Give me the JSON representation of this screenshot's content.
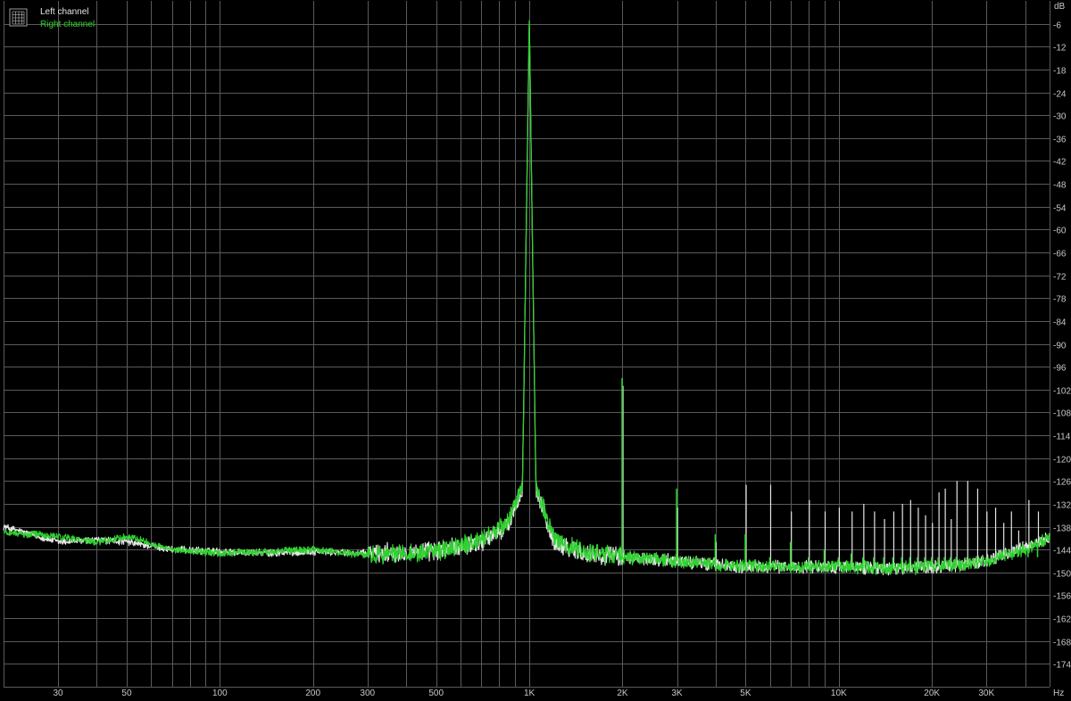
{
  "colors": {
    "background": "#000000",
    "grid": "#5a5a5a",
    "tick_text": "#c8c8c8",
    "left_channel": "#e6e6e6",
    "right_channel": "#2fd22f",
    "legend_icon": "#9a9a9a"
  },
  "legend": {
    "icon": "grid-icon",
    "placement": "top-left",
    "items": [
      {
        "label": "Left channel",
        "color": "#e6e6e6"
      },
      {
        "label": "Right channel",
        "color": "#2fd22f"
      }
    ]
  },
  "chart_data": {
    "type": "line",
    "title": "",
    "xscale": "log",
    "xlim": [
      20,
      48000
    ],
    "ylim": [
      -180,
      0
    ],
    "xunit": "Hz",
    "yunit": "dB",
    "xticks": [
      {
        "value": 30,
        "label": "30"
      },
      {
        "value": 50,
        "label": "50"
      },
      {
        "value": 100,
        "label": "100"
      },
      {
        "value": 200,
        "label": "200"
      },
      {
        "value": 300,
        "label": "300"
      },
      {
        "value": 500,
        "label": "500"
      },
      {
        "value": 1000,
        "label": "1K"
      },
      {
        "value": 2000,
        "label": "2K"
      },
      {
        "value": 3000,
        "label": "3K"
      },
      {
        "value": 5000,
        "label": "5K"
      },
      {
        "value": 10000,
        "label": "10K"
      },
      {
        "value": 20000,
        "label": "20K"
      },
      {
        "value": 30000,
        "label": "30K"
      }
    ],
    "yticks": [
      -6,
      -12,
      -18,
      -24,
      -30,
      -36,
      -42,
      -48,
      -54,
      -60,
      -66,
      -72,
      -78,
      -84,
      -90,
      -96,
      -102,
      -108,
      -114,
      -120,
      -126,
      -132,
      -138,
      -144,
      -150,
      -156,
      -162,
      -168,
      -174
    ],
    "grid": true,
    "noise_floor": {
      "x": [
        20,
        30,
        40,
        50,
        70,
        100,
        150,
        200,
        300,
        500,
        700,
        850,
        950,
        1000,
        1050,
        1200,
        1500,
        2000,
        3000,
        5000,
        7000,
        10000,
        15000,
        20000,
        25000,
        30000,
        40000,
        48000
      ],
      "left": [
        -138,
        -142,
        -141.5,
        -142,
        -144,
        -144.5,
        -145,
        -144.5,
        -145,
        -144.5,
        -142,
        -138,
        -128,
        -5,
        -128,
        -142,
        -145,
        -146,
        -147,
        -148.5,
        -148.5,
        -148.5,
        -149,
        -148.5,
        -148,
        -147,
        -143.5,
        -141
      ],
      "right": [
        -139.5,
        -140.5,
        -142,
        -140.5,
        -144,
        -145,
        -144.5,
        -144,
        -145.5,
        -144.5,
        -141.5,
        -137,
        -127,
        -4,
        -127,
        -141,
        -144.5,
        -146,
        -147,
        -148.5,
        -148.5,
        -148.5,
        -149,
        -148.5,
        -148,
        -147,
        -144,
        -141
      ]
    },
    "spurs": [
      {
        "x": 2000,
        "left": -101,
        "right": -99
      },
      {
        "x": 3000,
        "left": -133,
        "right": -128
      },
      {
        "x": 4000,
        "left": -142,
        "right": -140
      },
      {
        "x": 5000,
        "left": -127,
        "right": -140
      },
      {
        "x": 6000,
        "left": -127,
        "right": -146
      },
      {
        "x": 7000,
        "left": -134,
        "right": -142
      },
      {
        "x": 8000,
        "left": -131,
        "right": -146
      },
      {
        "x": 9000,
        "left": -134,
        "right": -144
      },
      {
        "x": 10000,
        "left": -133,
        "right": -146
      },
      {
        "x": 11000,
        "left": -134,
        "right": -145
      },
      {
        "x": 12000,
        "left": -132,
        "right": -146
      },
      {
        "x": 13000,
        "left": -134,
        "right": -146
      },
      {
        "x": 14000,
        "left": -136,
        "right": -146
      },
      {
        "x": 15000,
        "left": -134,
        "right": -146
      },
      {
        "x": 16000,
        "left": -132,
        "right": -146
      },
      {
        "x": 17000,
        "left": -131,
        "right": -146
      },
      {
        "x": 18000,
        "left": -133,
        "right": -146
      },
      {
        "x": 19000,
        "left": -135,
        "right": -146
      },
      {
        "x": 20000,
        "left": -137,
        "right": -146
      },
      {
        "x": 21000,
        "left": -129,
        "right": -146
      },
      {
        "x": 22000,
        "left": -128,
        "right": -146
      },
      {
        "x": 23000,
        "left": -136,
        "right": -146
      },
      {
        "x": 24000,
        "left": -126,
        "right": -146
      },
      {
        "x": 26000,
        "left": -126,
        "right": -146
      },
      {
        "x": 28000,
        "left": -128,
        "right": -146
      },
      {
        "x": 30000,
        "left": -134,
        "right": -146
      },
      {
        "x": 32000,
        "left": -133,
        "right": -146
      },
      {
        "x": 34000,
        "left": -137,
        "right": -146
      },
      {
        "x": 36000,
        "left": -134,
        "right": -146
      },
      {
        "x": 38000,
        "left": -139,
        "right": -146
      },
      {
        "x": 41000,
        "left": -131,
        "right": -146
      },
      {
        "x": 44000,
        "left": -134,
        "right": -146
      }
    ]
  }
}
